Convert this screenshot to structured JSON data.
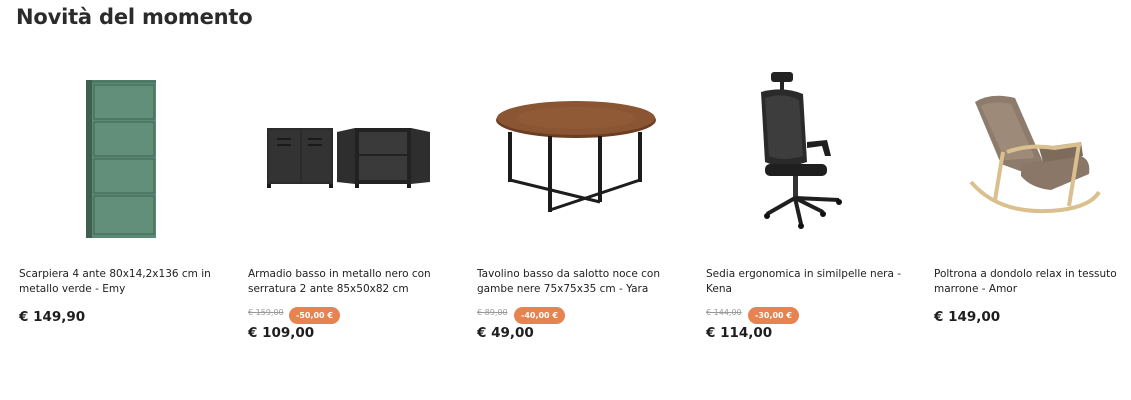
{
  "section": {
    "title": "Novità del momento"
  },
  "products": [
    {
      "name": "Scarpiera 4 ante 80x14,2x136 cm in metallo verde - Emy",
      "price": "€ 149,90",
      "image_icon": "green-shoe-cabinet-image"
    },
    {
      "name": "Armadio basso in metallo nero con serratura 2 ante 85x50x82 cm",
      "old_price": "€ 159,00",
      "discount": "-50,00 €",
      "price": "€ 109,00",
      "image_icon": "black-metal-cabinet-image"
    },
    {
      "name": "Tavolino basso da salotto noce con gambe nere 75x75x35 cm - Yara",
      "old_price": "€ 89,00",
      "discount": "-40,00 €",
      "price": "€ 49,00",
      "image_icon": "walnut-coffee-table-image"
    },
    {
      "name": "Sedia ergonomica in similpelle nera - Kena",
      "old_price": "€ 144,00",
      "discount": "-30,00 €",
      "price": "€ 114,00",
      "image_icon": "ergonomic-office-chair-image"
    },
    {
      "name": "Poltrona a dondolo relax in tessuto marrone - Amor",
      "price": "€ 149,00",
      "image_icon": "rocking-armchair-image"
    }
  ],
  "colors": {
    "discount_badge": "#e6834f",
    "text": "#1e1e1e",
    "old_price": "#9a9a9a"
  }
}
